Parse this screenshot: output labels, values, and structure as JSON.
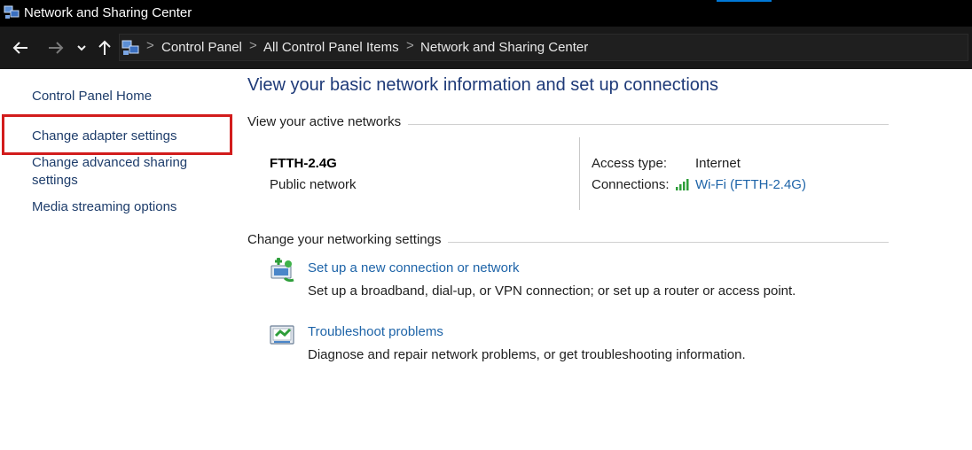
{
  "window": {
    "title": "Network and Sharing Center"
  },
  "address_bar": {
    "breadcrumbs": [
      "Control Panel",
      "All Control Panel Items",
      "Network and Sharing Center"
    ],
    "separator": ">"
  },
  "nav": {
    "back_icon": "back-arrow-icon",
    "forward_icon": "forward-arrow-icon",
    "recent_icon": "chevron-down-icon",
    "up_icon": "up-arrow-icon"
  },
  "sidebar": {
    "items": [
      {
        "label": "Control Panel Home"
      },
      {
        "label": "Change adapter settings"
      },
      {
        "label": "Change advanced sharing\nsettings"
      },
      {
        "label": "Media streaming options"
      }
    ],
    "highlight_color": "#d21c1c"
  },
  "main": {
    "heading": "View your basic network information and set up connections",
    "active_networks": {
      "section_title": "View your active networks",
      "network_name": "FTTH-2.4G",
      "network_type": "Public network",
      "access_type_label": "Access type:",
      "access_type_value": "Internet",
      "connections_label": "Connections:",
      "connections_value": "Wi-Fi (FTTH-2.4G)"
    },
    "settings": {
      "section_title": "Change your networking settings",
      "tasks": [
        {
          "icon": "new-connection-icon",
          "link": "Set up a new connection or network",
          "description": "Set up a broadband, dial-up, or VPN connection; or set up a router or access point."
        },
        {
          "icon": "troubleshoot-icon",
          "link": "Troubleshoot problems",
          "description": "Diagnose and repair network problems, or get troubleshooting information."
        }
      ]
    }
  },
  "colors": {
    "link": "#1e64a8",
    "heading": "#1e3a78",
    "titlebar": "#000000",
    "addressbar": "#191919"
  }
}
